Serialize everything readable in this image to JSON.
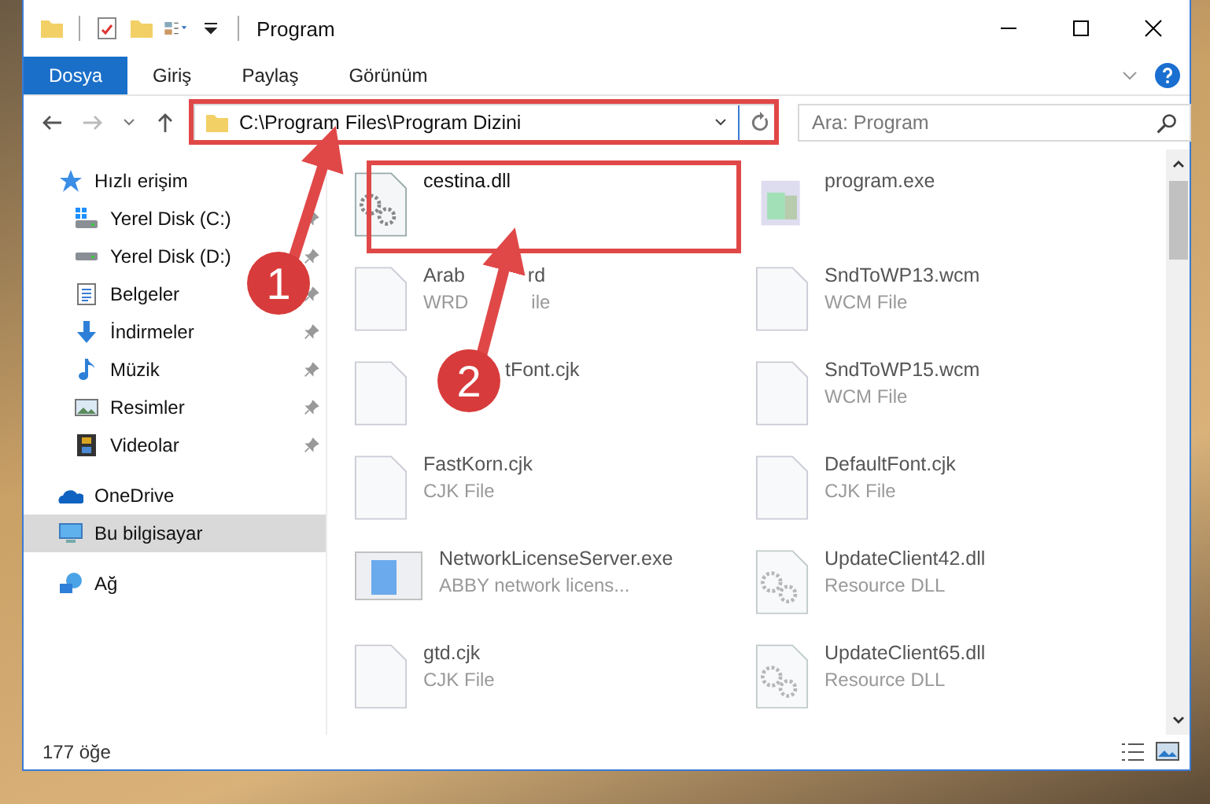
{
  "window": {
    "title": "Program"
  },
  "ribbon_tabs": [
    {
      "label": "Dosya",
      "selected": true
    },
    {
      "label": "Giriş",
      "selected": false
    },
    {
      "label": "Paylaş",
      "selected": false
    },
    {
      "label": "Görünüm",
      "selected": false
    }
  ],
  "address_bar": {
    "value": "C:\\Program Files\\Program Dizini"
  },
  "search": {
    "placeholder": "Ara: Program"
  },
  "sidebar": {
    "items": [
      {
        "label": "Hızlı erişim",
        "kind": "star",
        "selected": false,
        "children": [
          {
            "label": "Yerel Disk (C:)",
            "kind": "drive-windows",
            "pinned": true
          },
          {
            "label": "Yerel Disk (D:)",
            "kind": "drive",
            "pinned": true
          },
          {
            "label": "Belgeler",
            "kind": "document",
            "pinned": true
          },
          {
            "label": "İndirmeler",
            "kind": "download",
            "pinned": true
          },
          {
            "label": "Müzik",
            "kind": "music",
            "pinned": true
          },
          {
            "label": "Resimler",
            "kind": "picture",
            "pinned": true
          },
          {
            "label": "Videolar",
            "kind": "film",
            "pinned": true
          }
        ]
      },
      {
        "label": "OneDrive",
        "kind": "cloud",
        "selected": false
      },
      {
        "label": "Bu bilgisayar",
        "kind": "computer",
        "selected": true
      },
      {
        "label": "Ağ",
        "kind": "network",
        "selected": false
      }
    ]
  },
  "files": [
    {
      "name": "cestina.dll",
      "kind": "gear-file",
      "dimmed": false
    },
    {
      "name": "program.exe",
      "kind": "installer",
      "dimmed": true
    },
    {
      "name": "Arab",
      "name_end": "rd",
      "type": "WRD",
      "type_end": "ile",
      "kind": "blank-file",
      "dimmed": true
    },
    {
      "name": "SndToWP13.wcm",
      "type": "WCM File",
      "kind": "blank-file",
      "dimmed": true
    },
    {
      "name": "tFont.cjk",
      "kind": "blank-file",
      "dimmed": true,
      "covered": true
    },
    {
      "name": "SndToWP15.wcm",
      "type": "WCM File",
      "kind": "blank-file",
      "dimmed": true
    },
    {
      "name": "FastKorn.cjk",
      "type": "CJK File",
      "kind": "blank-file",
      "dimmed": true
    },
    {
      "name": "DefaultFont.cjk",
      "type": "CJK File",
      "kind": "blank-file",
      "dimmed": true
    },
    {
      "name": "NetworkLicenseServer.exe",
      "type": "ABBY network licens...",
      "kind": "app-window",
      "dimmed": true
    },
    {
      "name": "UpdateClient42.dll",
      "type": "Resource DLL",
      "kind": "gear-file",
      "dimmed": true
    },
    {
      "name": "gtd.cjk",
      "type": "CJK File",
      "kind": "blank-file",
      "dimmed": true
    },
    {
      "name": "UpdateClient65.dll",
      "type": "Resource DLL",
      "kind": "gear-file",
      "dimmed": true
    }
  ],
  "status_bar": {
    "count": "177 öğe"
  },
  "annotations": [
    {
      "label": "1"
    },
    {
      "label": "2"
    }
  ]
}
